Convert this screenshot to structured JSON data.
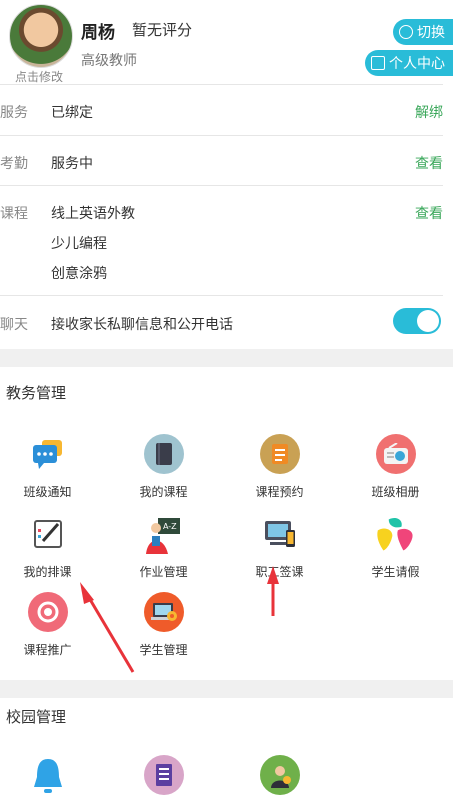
{
  "profile": {
    "name": "周杨",
    "rating": "暂无评分",
    "title": "高级教师",
    "edit_hint": "点击修改",
    "switch_label": "切换",
    "profile_label": "个人中心"
  },
  "rows": {
    "service": {
      "label": "服务",
      "value": "已绑定",
      "action": "解绑"
    },
    "attendance": {
      "label": "考勤",
      "value": "服务中",
      "action": "查看"
    },
    "courses": {
      "label": "课程",
      "values": [
        "线上英语外教",
        "少儿编程",
        "创意涂鸦"
      ],
      "action": "查看"
    },
    "chat": {
      "label": "聊天",
      "value": "接收家长私聊信息和公开电话",
      "toggle_on": true
    }
  },
  "academic": {
    "title": "教务管理",
    "items": [
      {
        "label": "班级通知",
        "icon": "chat-bubble-icon"
      },
      {
        "label": "我的课程",
        "icon": "book-icon"
      },
      {
        "label": "课程预约",
        "icon": "calendar-book-icon"
      },
      {
        "label": "班级相册",
        "icon": "radio-photo-icon"
      },
      {
        "label": "我的排课",
        "icon": "pen-notebook-icon"
      },
      {
        "label": "作业管理",
        "icon": "teacher-board-icon"
      },
      {
        "label": "职工签课",
        "icon": "devices-icon"
      },
      {
        "label": "学生请假",
        "icon": "colorful-leaves-icon"
      },
      {
        "label": "课程推广",
        "icon": "promo-eye-icon"
      },
      {
        "label": "学生管理",
        "icon": "laptop-gear-icon"
      }
    ]
  },
  "campus": {
    "title": "校园管理",
    "items": [
      {
        "icon": "bell-icon"
      },
      {
        "icon": "document-icon"
      },
      {
        "icon": "staff-icon"
      }
    ]
  },
  "colors": {
    "accent": "#29bcd8",
    "link": "#3aa75a",
    "arrow": "#e8333a"
  }
}
